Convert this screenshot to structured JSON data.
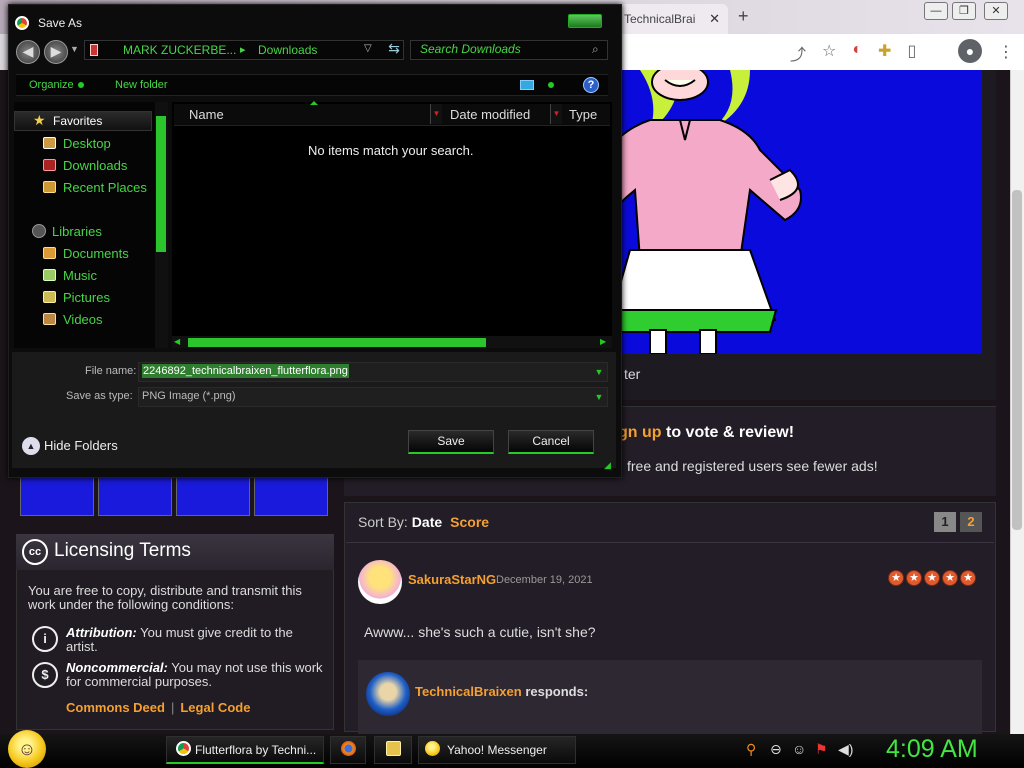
{
  "browser": {
    "tab_title": "TechnicalBrai",
    "tab_close": "✕",
    "newtab": "+",
    "win_min": "—",
    "win_max": "❐",
    "win_close": "✕",
    "icons": [
      "share-icon",
      "star-icon",
      "extension-icon",
      "puzzle-icon",
      "sidebar-icon"
    ],
    "kebab": "⋮"
  },
  "page": {
    "art_caption": "ter",
    "signup": {
      "prefix": "gn up",
      "rest": " to vote & review!",
      "sub": "free and registered users see fewer ads!"
    },
    "licensing": {
      "title": "Licensing Terms",
      "cc": "cc",
      "intro": "You are free to copy, distribute and transmit this work under the following conditions:",
      "items": [
        {
          "term": "Attribution:",
          "desc": " You must give credit to the artist.",
          "icon": "i"
        },
        {
          "term": "Noncommercial:",
          "desc": " You may not use this work for commercial purposes.",
          "icon": "$"
        }
      ],
      "links": [
        "Commons Deed",
        "Legal Code"
      ]
    },
    "reviews": {
      "sort_label": "Sort By:",
      "sort_date": "Date",
      "sort_score": "Score",
      "pages": [
        "1",
        "2"
      ],
      "review": {
        "user": "SakuraStarNG",
        "date": "December 19, 2021",
        "stars": 5,
        "text": "Awww... she's such a cutie, isn't she?"
      },
      "response": {
        "user": "TechnicalBraixen",
        "suffix": " responds:"
      }
    }
  },
  "dialog": {
    "title": "Save As",
    "breadcrumb": {
      "user": "MARK ZUCKERBE...",
      "sep": "▸",
      "folder": "Downloads"
    },
    "search_placeholder": "Search Downloads",
    "toolbar": {
      "organize": "Organize",
      "new_folder": "New folder",
      "help": "?"
    },
    "nav": {
      "favorites": "Favorites",
      "fav_items": [
        "Desktop",
        "Downloads",
        "Recent Places"
      ],
      "libraries": "Libraries",
      "lib_items": [
        "Documents",
        "Music",
        "Pictures",
        "Videos"
      ]
    },
    "columns": [
      "Name",
      "Date modified",
      "Type"
    ],
    "empty_message": "No items match your search.",
    "file_name_label": "File name:",
    "file_name": "2246892_technicalbraixen_flutterflora.png",
    "save_type_label": "Save as type:",
    "save_type": "PNG Image (*.png)",
    "hide_folders": "Hide Folders",
    "save_button": "Save",
    "cancel_button": "Cancel",
    "colors": {
      "accent": "#46d646",
      "bg": "#0c0c0c"
    }
  },
  "taskbar": {
    "tasks": [
      {
        "label": "Flutterflora by Techni...",
        "icon": "chrome-icon"
      },
      {
        "label": "",
        "icon": "firefox-icon"
      },
      {
        "label": "",
        "icon": "folder-icon"
      },
      {
        "label": "Yahoo! Messenger",
        "icon": "yahoo-messenger-icon"
      }
    ],
    "clock": "4:09 AM"
  }
}
